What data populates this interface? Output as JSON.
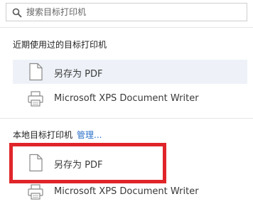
{
  "search": {
    "placeholder": "搜索目标打印机",
    "icon": "search-icon"
  },
  "recent": {
    "title": "近期使用过的目标打印机",
    "items": [
      {
        "label": "另存为 PDF",
        "icon": "document-icon",
        "selected": true
      },
      {
        "label": "Microsoft XPS Document Writer",
        "icon": "printer-icon",
        "selected": false
      }
    ]
  },
  "local": {
    "title": "本地目标打印机",
    "manage_label": "管理...",
    "items": [
      {
        "label": "另存为 PDF",
        "icon": "document-icon",
        "highlighted": true
      },
      {
        "label": "Microsoft XPS Document Writer",
        "icon": "printer-icon",
        "highlighted": false
      }
    ]
  },
  "colors": {
    "link": "#2a6fc9",
    "selected_row": "#eef2f8",
    "highlight_annotation": "#e0252a"
  }
}
